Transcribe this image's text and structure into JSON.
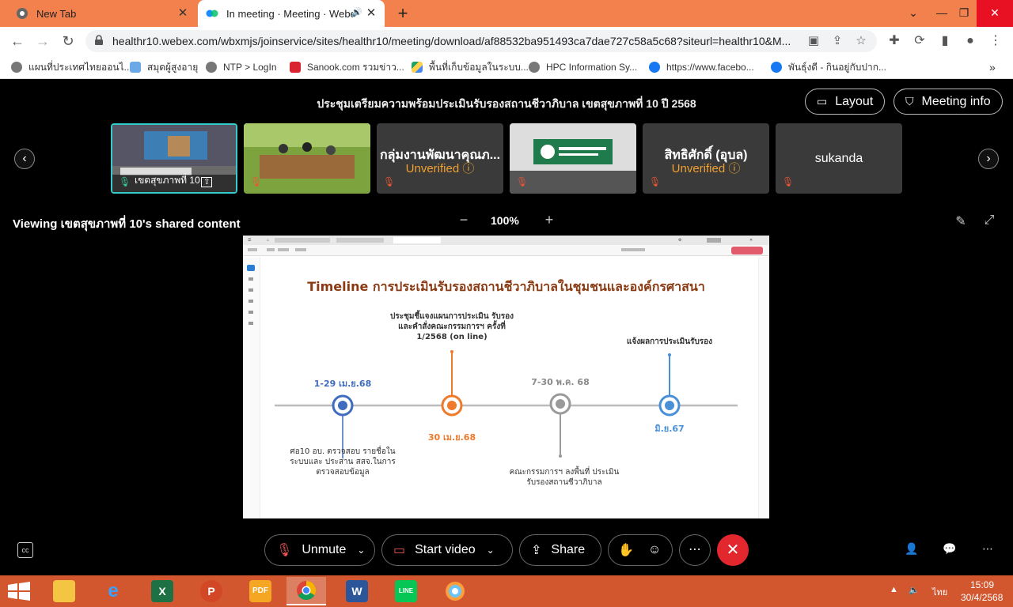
{
  "browser": {
    "tabs": [
      {
        "title": "New Tab",
        "icon": "chrome-icon"
      },
      {
        "title": "In meeting · Meeting · Webe",
        "icon": "webex-icon"
      }
    ],
    "url": "healthr10.webex.com/wbxmjs/joinservice/sites/healthr10/meeting/download/af88532ba951493ca7dae727c58a5c68?siteurl=healthr10&M...",
    "bookmarks": [
      "แผนที่ประเทศไทยออนไ...",
      "สมุดผู้สูงอายุ",
      "NTP > LogIn",
      "Sanook.com รวมข่าว...",
      "พื้นที่เก็บข้อมูลในระบบ...",
      "HPC Information Sy...",
      "https://www.facebo...",
      "พันธ์ุงดี - กินอยู่กับปาก..."
    ]
  },
  "meeting": {
    "title": "ประชุมเตรียมความพร้อมประเมินรับรองสถานชีวาภิบาล เขตสุขภาพที่ 10 ปี 2568",
    "layout_label": "Layout",
    "info_label": "Meeting info",
    "participants": [
      {
        "name": "เขตสุขภาพที่ 10",
        "type": "video"
      },
      {
        "name": "",
        "type": "video"
      },
      {
        "name": "กลุ่มงานพัฒนาคุณภ...",
        "status": "Unverified",
        "type": "avatar"
      },
      {
        "name": "",
        "type": "video"
      },
      {
        "name": "สิทธิศักดิ์ (อุบล)",
        "status": "Unverified",
        "type": "avatar"
      },
      {
        "name": "sukanda",
        "type": "avatar"
      }
    ],
    "viewing_text": "Viewing เขตสุขภาพที่ 10's shared content",
    "zoom": "100%",
    "controls": {
      "unmute": "Unmute",
      "start_video": "Start video",
      "share": "Share"
    }
  },
  "shared_content": {
    "title": "Timeline การประเมินรับรองสถานชีวาภิบาลในชุมชนและองค์กรศาสนา",
    "milestones": [
      {
        "date": "1-29 เม.ย.68",
        "text": "ศอ10 อบ. ตรวจสอบ รายชื่อในระบบและ ประสาน สสจ.ในการ ตรวจสอบข้อมูล",
        "color": "#3f6cbf"
      },
      {
        "date": "30 เม.ย.68",
        "text": "ประชุมชี้แจงแผนการประเมิน รับรองและคำสั่งคณะกรรมการฯ ครั้งที่ 1/2568 (on line)",
        "color": "#ef7a2a"
      },
      {
        "date": "7-30 พ.ค. 68",
        "text": "คณะกรรมการฯ ลงพื้นที่ ประเมินรับรองสถานชีวาภิบาล",
        "color": "#9a9a9a"
      },
      {
        "date": "มิ.ย.67",
        "text": "แจ้งผลการประเมินรับรอง",
        "color": "#4a90d9"
      }
    ]
  },
  "taskbar": {
    "time": "15:09",
    "date": "30/4/2568",
    "lang": "ไทย"
  }
}
